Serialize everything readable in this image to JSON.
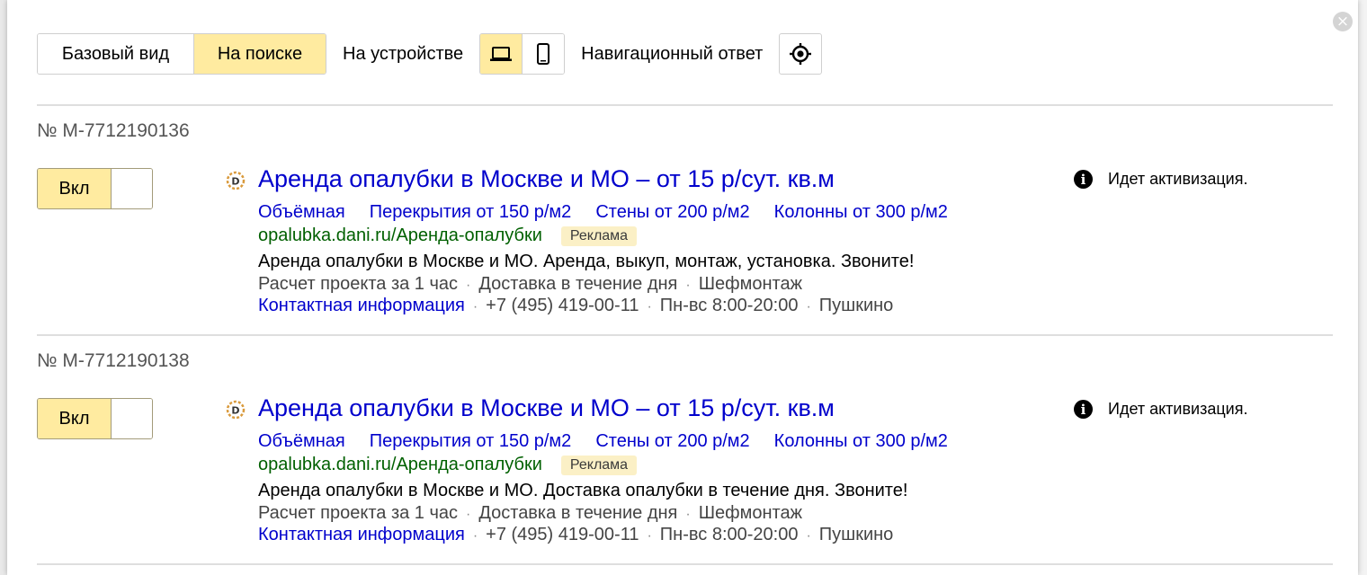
{
  "toolbar": {
    "base_view": "Базовый вид",
    "search_view": "На поиске",
    "device_label": "На устройстве",
    "nav_answer": "Навигационный ответ"
  },
  "icons": {
    "close": "close-icon",
    "laptop": "laptop-icon",
    "phone": "phone-icon",
    "target": "target-icon",
    "favicon": "favicon-icon",
    "info": "info-icon"
  },
  "colors": {
    "accent": "#ffeba0",
    "link": "#0000cc",
    "url": "#006000",
    "badge_bg": "#fbf0c6"
  },
  "ads": [
    {
      "number": "№ M-7712190136",
      "toggle": "Вкл",
      "title": "Аренда опалубки в Москве и МО – от 15 р/сут. кв.м",
      "sitelinks": [
        "Объёмная",
        "Перекрытия от 150 р/м2",
        "Стены от 200 р/м2",
        "Колонны от 300 р/м2"
      ],
      "url": "opalubka.dani.ru/Аренда-опалубки",
      "badge": "Реклама",
      "description": "Аренда опалубки в Москве и МО. Аренда, выкуп, монтаж, установка. Звоните!",
      "callouts": [
        "Расчет проекта за 1 час",
        "Доставка в течение дня",
        "Шефмонтаж"
      ],
      "contact_link": "Контактная информация",
      "phone": "+7 (495) 419-00-11",
      "hours": "Пн-вс 8:00-20:00",
      "city": "Пушкино",
      "status": "Идет активизация."
    },
    {
      "number": "№ M-7712190138",
      "toggle": "Вкл",
      "title": "Аренда опалубки в Москве и МО – от 15 р/сут. кв.м",
      "sitelinks": [
        "Объёмная",
        "Перекрытия от 150 р/м2",
        "Стены от 200 р/м2",
        "Колонны от 300 р/м2"
      ],
      "url": "opalubka.dani.ru/Аренда-опалубки",
      "badge": "Реклама",
      "description": "Аренда опалубки в Москве и МО. Доставка опалубки в течение дня. Звоните!",
      "callouts": [
        "Расчет проекта за 1 час",
        "Доставка в течение дня",
        "Шефмонтаж"
      ],
      "contact_link": "Контактная информация",
      "phone": "+7 (495) 419-00-11",
      "hours": "Пн-вс 8:00-20:00",
      "city": "Пушкино",
      "status": "Идет активизация."
    }
  ]
}
